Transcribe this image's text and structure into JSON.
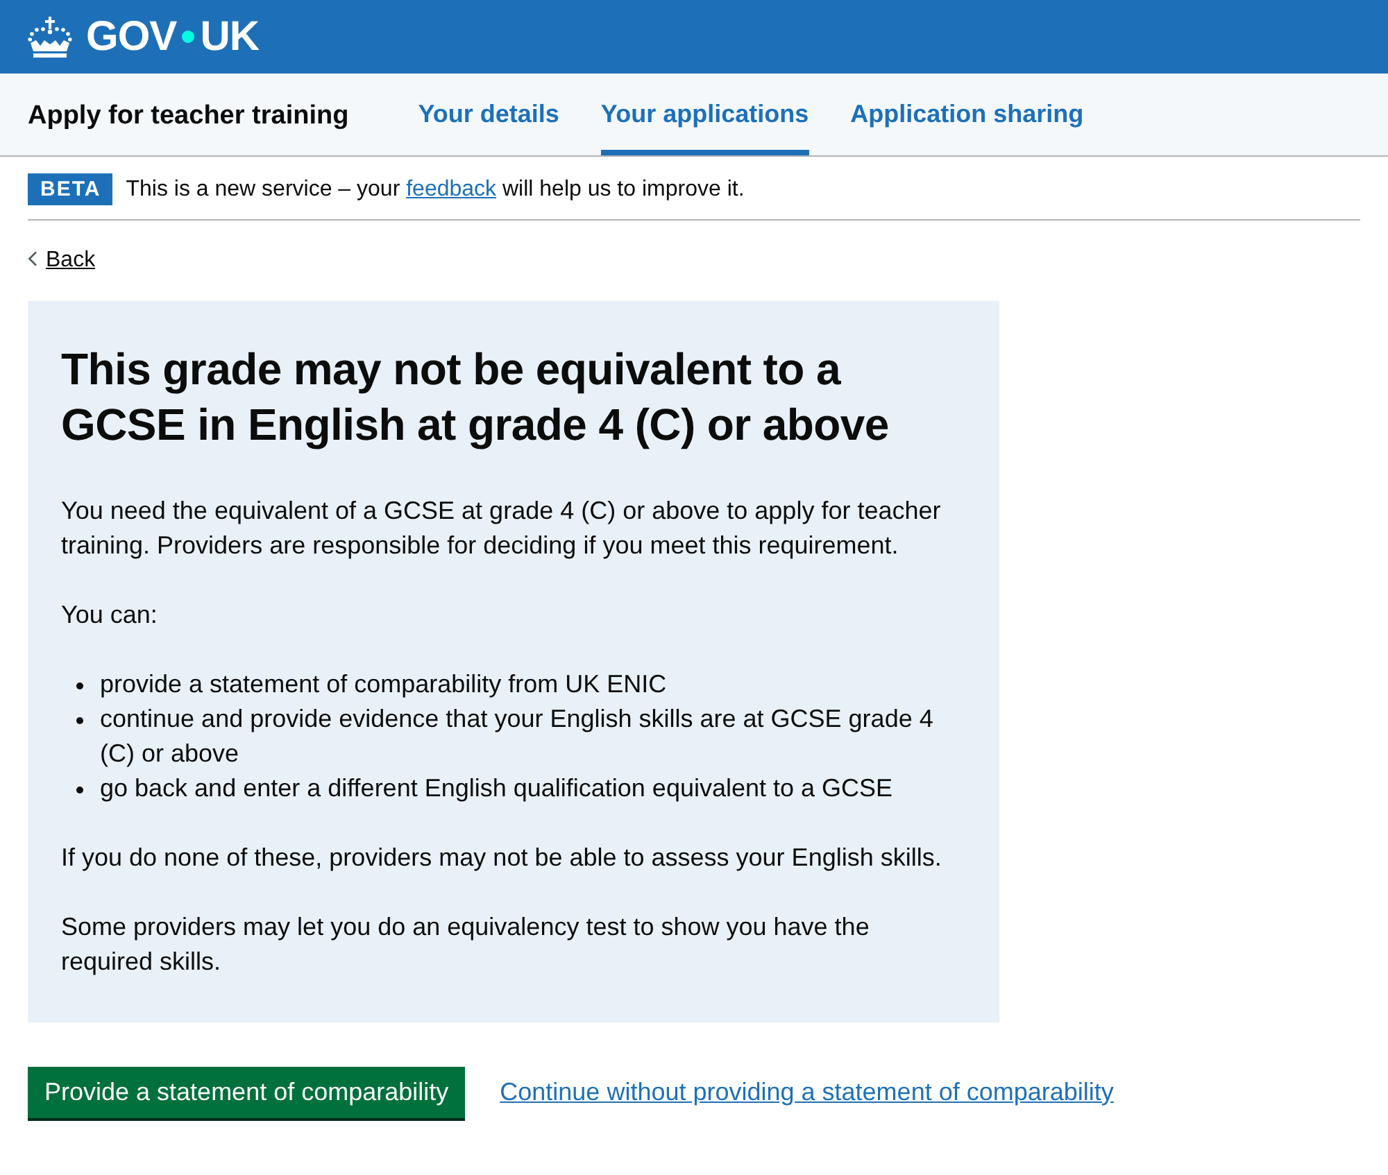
{
  "header": {
    "logo": [
      "GOV",
      "UK"
    ]
  },
  "service_nav": {
    "service_name": "Apply for teacher training",
    "items": [
      {
        "label": "Your details",
        "selected": false
      },
      {
        "label": "Your applications",
        "selected": true
      },
      {
        "label": "Application sharing",
        "selected": false
      }
    ]
  },
  "phase_banner": {
    "tag": "BETA",
    "message": {
      "before": "This is a new service – your",
      "link": "feedback",
      "after": "will help us to improve it."
    }
  },
  "back_link": "Back",
  "inset": {
    "heading": "This grade may not be equivalent to a GCSE in English at grade 4 (C) or above",
    "blocks": [
      {
        "kind": "paragraph",
        "text": "You need the equivalent of a GCSE at grade 4 (C) or above to apply for teacher training. Providers are responsible for deciding if you meet this requirement."
      },
      {
        "kind": "paragraph",
        "text": "You can:"
      },
      {
        "kind": "list",
        "items": [
          "provide a statement of comparability from UK ENIC",
          "continue and provide evidence that your English skills are at GCSE grade 4 (C) or above",
          "go back and enter a different English qualification equivalent to a GCSE"
        ]
      },
      {
        "kind": "paragraph",
        "text": "If you do none of these, providers may not be able to assess your English skills."
      },
      {
        "kind": "paragraph",
        "text": "Some providers may let you do an equivalency test to show you have the required skills."
      }
    ]
  },
  "actions": {
    "primary_button": "Provide a statement of comparability",
    "secondary_link": "Continue without providing a statement of comparability"
  }
}
